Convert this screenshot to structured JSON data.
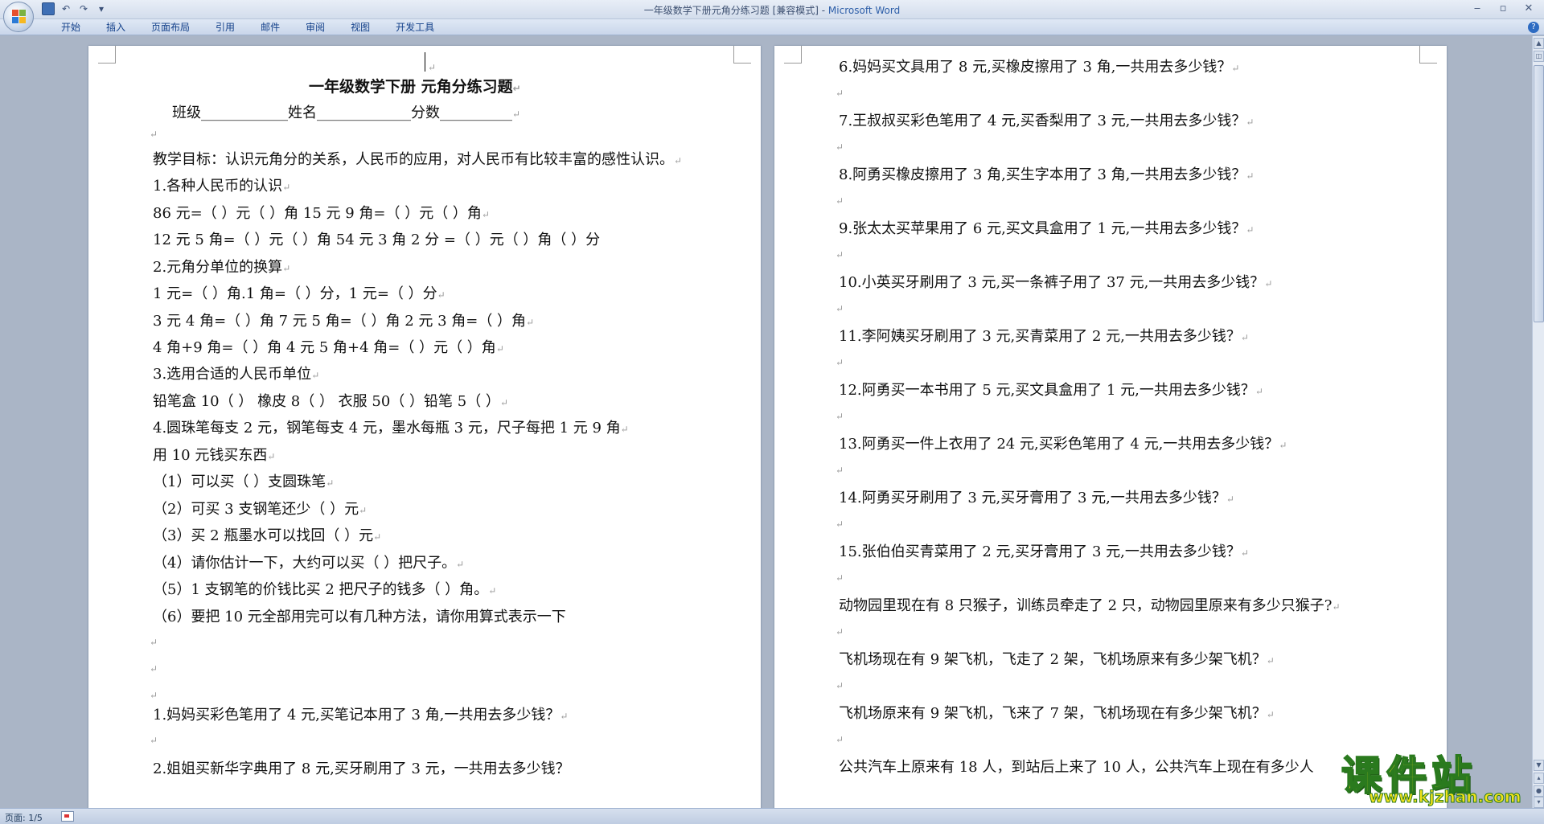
{
  "window": {
    "title_doc": "一年级数学下册元角分练习题 [兼容模式] - ",
    "title_app": "Microsoft Word"
  },
  "qat": {
    "undo": "↶",
    "redo": "↷",
    "customize": "▾"
  },
  "window_controls": {
    "minimize": "‒",
    "maximize": "▫",
    "close": "✕"
  },
  "ribbon": {
    "tabs": [
      "开始",
      "插入",
      "页面布局",
      "引用",
      "邮件",
      "审阅",
      "视图",
      "开发工具"
    ],
    "help": "?"
  },
  "left_page": {
    "heading": "一年级数学下册  元角分练习题",
    "info_line": "班级____________姓名_____________分数__________",
    "lines": [
      "教学目标：认识元角分的关系，人民币的应用，对人民币有比较丰富的感性认识。",
      "1.各种人民币的认识",
      "86 元=（   ）元（   ）角  15 元 9 角=（   ）元（   ）角",
      "12 元 5 角=（   ）元（   ）角  54 元 3 角 2 分  =（   ）元（   ）角（   ）分",
      "2.元角分单位的换算",
      "1 元=（   ）角.1 角=（   ）分，1 元=（   ）分",
      "3 元 4 角=（   ）角  7 元 5 角=（   ）角  2 元 3 角=（   ）角",
      "4 角+9 角=（   ）角  4 元 5 角+4 角=（   ）元（   ）角",
      "3.选用合适的人民币单位",
      "铅笔盒 10（   ）   橡皮 8（   ）   衣服 50（   ）铅笔 5（   ）",
      "4.圆珠笔每支 2 元，钢笔每支 4 元，墨水每瓶 3 元，尺子每把 1 元 9 角",
      "用 10 元钱买东西",
      "（1）可以买（   ）支圆珠笔",
      "（2）可买 3 支钢笔还少（   ）元",
      "（3）买 2 瓶墨水可以找回（   ）元",
      "（4）请你估计一下，大约可以买（   ）把尺子。",
      "（5）1 支钢笔的价钱比买 2 把尺子的钱多（   ）角。",
      "（6）要把 10 元全部用完可以有几种方法，请你用算式表示一下",
      "1.妈妈买彩色笔用了 4 元,买笔记本用了 3 角,一共用去多少钱？",
      "2.姐姐买新华字典用了 8 元,买牙刷用了 3 元，一共用去多少钱？"
    ]
  },
  "right_page": {
    "lines": [
      "6.妈妈买文具用了 8 元,买橡皮擦用了 3 角,一共用去多少钱？",
      "7.王叔叔买彩色笔用了 4 元,买香梨用了 3 元,一共用去多少钱？",
      "8.阿勇买橡皮擦用了 3 角,买生字本用了 3 角,一共用去多少钱？",
      "9.张太太买苹果用了 6 元,买文具盒用了 1 元,一共用去多少钱？",
      "10.小英买牙刷用了 3 元,买一条裤子用了 37 元,一共用去多少钱？",
      "11.李阿姨买牙刷用了 3 元,买青菜用了 2 元,一共用去多少钱？",
      "12.阿勇买一本书用了 5 元,买文具盒用了 1 元,一共用去多少钱？",
      "13.阿勇买一件上衣用了 24 元,买彩色笔用了 4 元,一共用去多少钱？",
      "14.阿勇买牙刷用了 3 元,买牙膏用了 3 元,一共用去多少钱？",
      "15.张伯伯买青菜用了 2 元,买牙膏用了 3 元,一共用去多少钱？",
      "动物园里现在有 8 只猴子，训练员牵走了 2 只，动物园里原来有多少只猴子?",
      "飞机场现在有 9 架飞机，飞走了 2 架，飞机场原来有多少架飞机？",
      "飞机场原来有 9 架飞机，飞来了 7 架，飞机场现在有多少架飞机？",
      "公共汽车上原来有 18 人，到站后上来了 10 人，公共汽车上现在有多少人"
    ]
  },
  "marks": {
    "paragraph": "↵"
  },
  "statusbar": {
    "page_info": "页面: 1/5"
  },
  "watermark": {
    "text": "课件站",
    "url": "www.kjzhan.com"
  }
}
